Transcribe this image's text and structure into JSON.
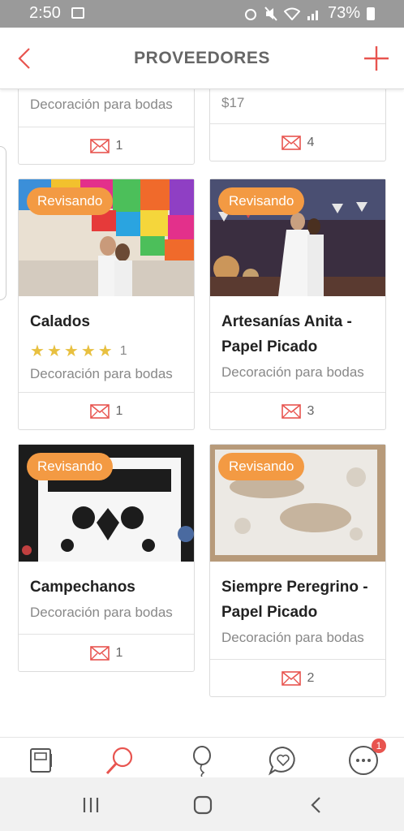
{
  "status": {
    "time": "2:50",
    "battery": "73%"
  },
  "header": {
    "title": "PROVEEDORES"
  },
  "cards": [
    {
      "category": "Decoración para bodas",
      "messages": "1"
    },
    {
      "price": "$17",
      "messages": "4"
    },
    {
      "badge": "Revisando",
      "name": "Calados",
      "rating_count": "1",
      "category": "Decoración para bodas",
      "messages": "1"
    },
    {
      "badge": "Revisando",
      "name": "Artesanías Anita - Papel Picado",
      "category": "Decoración para bodas",
      "messages": "3"
    },
    {
      "badge": "Revisando",
      "name": "Campechanos",
      "category": "Decoración para bodas",
      "messages": "1"
    },
    {
      "badge": "Revisando",
      "name": "Siempre Peregrino - Papel Picado",
      "category": "Decoración para bodas",
      "messages": "2"
    }
  ],
  "nav": {
    "notification_count": "1"
  },
  "colors": {
    "accent": "#e8544f",
    "badge": "#f39a43"
  }
}
